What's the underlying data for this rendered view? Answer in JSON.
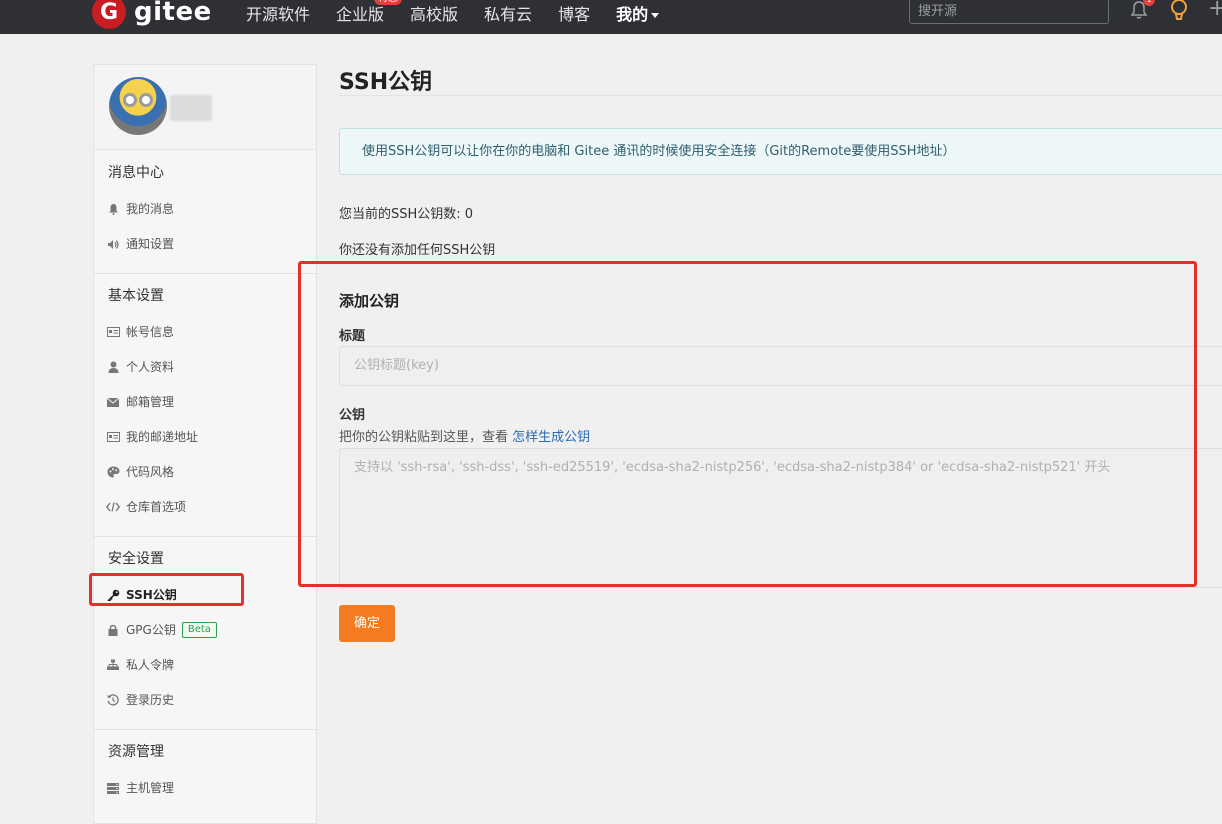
{
  "header": {
    "logo_mark": "G",
    "logo_text": "gitee",
    "nav": [
      {
        "label": "开源软件"
      },
      {
        "label": "企业版",
        "badge": "特惠"
      },
      {
        "label": "高校版"
      },
      {
        "label": "私有云"
      },
      {
        "label": "博客"
      },
      {
        "label": "我的"
      }
    ],
    "search_placeholder": "搜开源",
    "notification_count": "1",
    "plus": "+"
  },
  "sidebar": {
    "sections": [
      {
        "title": "消息中心",
        "items": [
          {
            "label": "我的消息",
            "icon": "bell-icon"
          },
          {
            "label": "通知设置",
            "icon": "speaker-icon"
          }
        ]
      },
      {
        "title": "基本设置",
        "items": [
          {
            "label": "帐号信息",
            "icon": "id-card-icon"
          },
          {
            "label": "个人资料",
            "icon": "user-icon"
          },
          {
            "label": "邮箱管理",
            "icon": "envelope-icon"
          },
          {
            "label": "我的邮递地址",
            "icon": "address-card-icon"
          },
          {
            "label": "代码风格",
            "icon": "palette-icon"
          },
          {
            "label": "仓库首选项",
            "icon": "code-icon"
          }
        ]
      },
      {
        "title": "安全设置",
        "items": [
          {
            "label": "SSH公钥",
            "icon": "key-icon",
            "active": true
          },
          {
            "label": "GPG公钥",
            "icon": "lock-icon",
            "badge": "Beta"
          },
          {
            "label": "私人令牌",
            "icon": "sitemap-icon"
          },
          {
            "label": "登录历史",
            "icon": "history-icon"
          }
        ]
      },
      {
        "title": "资源管理",
        "items": [
          {
            "label": "主机管理",
            "icon": "server-icon"
          }
        ]
      }
    ]
  },
  "main": {
    "title": "SSH公钥",
    "info": "使用SSH公钥可以让你在你的电脑和 Gitee 通讯的时候使用安全连接（Git的Remote要使用SSH地址）",
    "key_count_text": "您当前的SSH公钥数: 0",
    "empty_text": "你还没有添加任何SSH公钥",
    "add_heading": "添加公钥",
    "title_label": "标题",
    "title_placeholder": "公钥标题(key)",
    "key_label": "公钥",
    "help_text": "把你的公钥粘贴到这里，查看 ",
    "help_link": "怎样生成公钥",
    "key_placeholder": "支持以 'ssh-rsa', 'ssh-dss', 'ssh-ed25519', 'ecdsa-sha2-nistp256', 'ecdsa-sha2-nistp384' or 'ecdsa-sha2-nistp521' 开头",
    "submit_label": "确定"
  },
  "colors": {
    "topbar": "#2e3035",
    "brand": "#c71d23",
    "submit": "#f47b20",
    "annotation": "#e4302a",
    "beta": "#2aa14c"
  }
}
